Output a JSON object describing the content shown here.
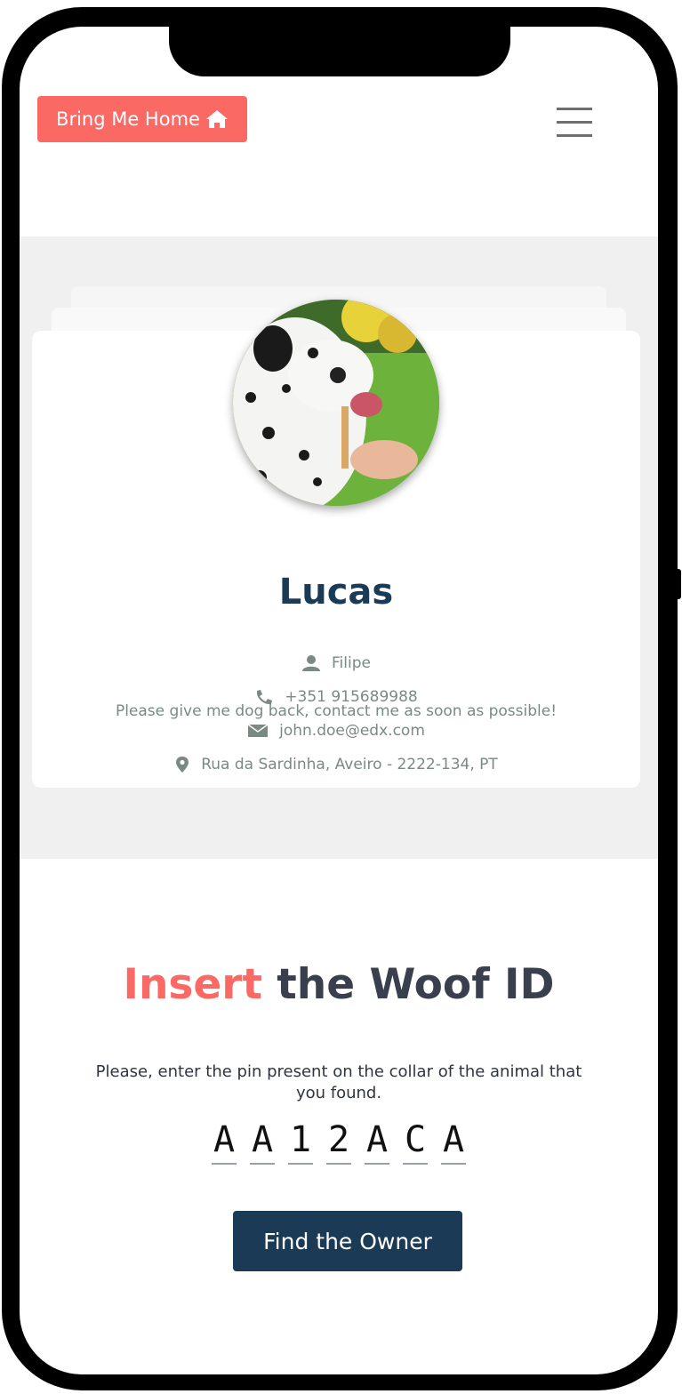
{
  "header": {
    "brand_label": "Bring Me Home",
    "brand_icon": "home-icon",
    "menu_icon": "hamburger-menu-icon"
  },
  "profile": {
    "pet_name": "Lucas",
    "owner_name": "Filipe",
    "phone": "+351 915689988",
    "email": "john.doe@edx.com",
    "address": "Rua da Sardinha, Aveiro - 2222-134, PT",
    "message": "Please give me dog back, contact me as soon as possible!",
    "icons": [
      "user-icon",
      "phone-icon",
      "envelope-icon",
      "map-pin-icon"
    ]
  },
  "woof_id": {
    "title_accent": "Insert",
    "title_rest": "the Woof ID",
    "instructions": "Please, enter the pin present on the collar of the animal that you found.",
    "pin": [
      "A",
      "A",
      "1",
      "2",
      "A",
      "C",
      "A"
    ],
    "submit_label": "Find the Owner"
  },
  "colors": {
    "accent": "#fb6964",
    "navy": "#1a3a55",
    "muted_text": "#7a8a82",
    "section_bg": "#f0f0f0"
  }
}
